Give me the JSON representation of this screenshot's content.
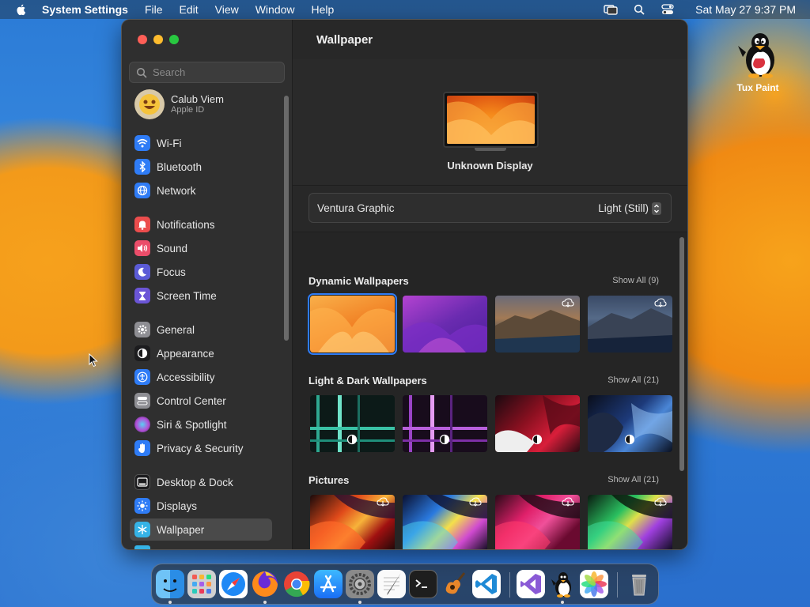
{
  "menubar": {
    "app_name": "System Settings",
    "menus": [
      "File",
      "Edit",
      "View",
      "Window",
      "Help"
    ],
    "clock": "Sat May 27  9:37 PM"
  },
  "desktop": {
    "icon_label": "Tux Paint"
  },
  "window": {
    "search_placeholder": "Search",
    "profile": {
      "name": "Calub Viem",
      "subtitle": "Apple ID"
    },
    "sidebar": [
      {
        "label": "Wi-Fi",
        "icon": "wifi-icon",
        "color": "#2f7cf6"
      },
      {
        "label": "Bluetooth",
        "icon": "bluetooth-icon",
        "color": "#2f7cf6"
      },
      {
        "label": "Network",
        "icon": "globe-icon",
        "color": "#2f7cf6"
      },
      {
        "label": "Notifications",
        "icon": "bell-icon",
        "color": "#eb4d4d"
      },
      {
        "label": "Sound",
        "icon": "speaker-icon",
        "color": "#eb4d6a"
      },
      {
        "label": "Focus",
        "icon": "moon-icon",
        "color": "#5b5bd6"
      },
      {
        "label": "Screen Time",
        "icon": "hourglass-icon",
        "color": "#6b55d6"
      },
      {
        "label": "General",
        "icon": "gear-icon",
        "color": "#8e8e93"
      },
      {
        "label": "Appearance",
        "icon": "appearance-icon",
        "color": "#1c1c1e"
      },
      {
        "label": "Accessibility",
        "icon": "accessibility-icon",
        "color": "#2f7cf6"
      },
      {
        "label": "Control Center",
        "icon": "toggles-icon",
        "color": "#8e8e93"
      },
      {
        "label": "Siri & Spotlight",
        "icon": "siri-icon",
        "color": "#c44fd6"
      },
      {
        "label": "Privacy & Security",
        "icon": "hand-icon",
        "color": "#2f7cf6"
      },
      {
        "label": "Desktop & Dock",
        "icon": "dock-icon",
        "color": "#1c1c1e"
      },
      {
        "label": "Displays",
        "icon": "sun-icon",
        "color": "#2f7cf6"
      },
      {
        "label": "Wallpaper",
        "icon": "snowflake-icon",
        "color": "#35b3e6"
      }
    ],
    "content": {
      "title": "Wallpaper",
      "display_name": "Unknown Display",
      "current_wallpaper": "Ventura Graphic",
      "appearance_mode": "Light (Still)",
      "sections": [
        {
          "title": "Dynamic Wallpapers",
          "show_all": "Show All (9)"
        },
        {
          "title": "Light & Dark Wallpapers",
          "show_all": "Show All (21)"
        },
        {
          "title": "Pictures",
          "show_all": "Show All (21)"
        }
      ]
    }
  },
  "dock": {
    "apps": [
      "Finder",
      "Launchpad",
      "Safari",
      "Firefox",
      "Chrome",
      "App Store",
      "System Settings",
      "TextEdit",
      "Terminal",
      "GarageBand",
      "VS Code",
      "Visual Studio",
      "Tux Paint",
      "Photos",
      "Trash"
    ]
  }
}
